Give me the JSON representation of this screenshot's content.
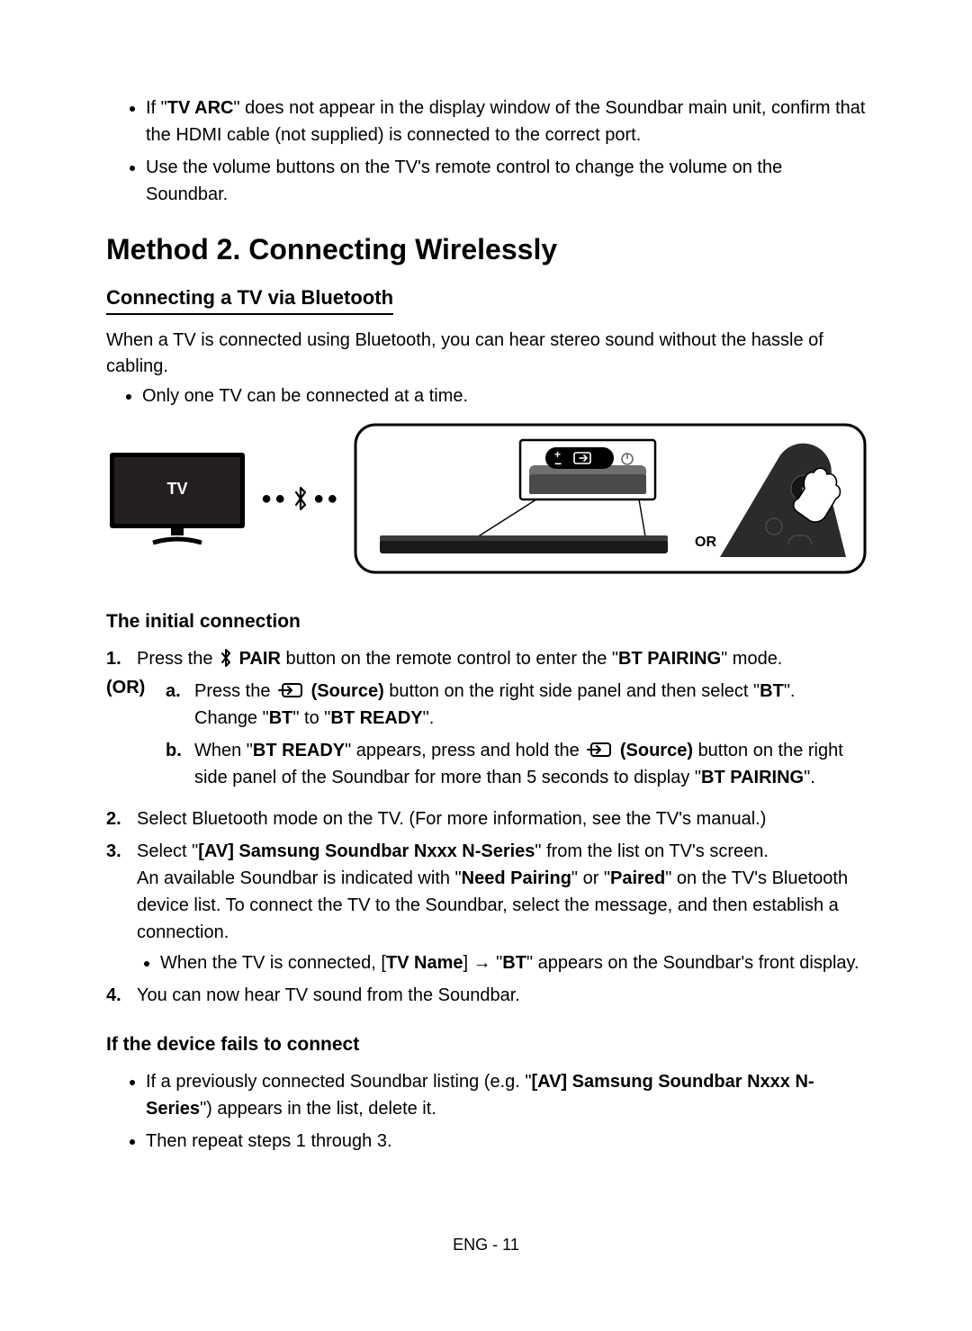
{
  "top_bullets": {
    "b0": {
      "pre": "If \"",
      "bold": "TV ARC",
      "post": "\" does not appear in the display window of the Soundbar main unit, confirm that the HDMI cable (not supplied) is connected to the correct port."
    },
    "b1": "Use the volume buttons on the TV's remote control to change the volume on the Soundbar."
  },
  "method_title": "Method 2. Connecting Wirelessly",
  "subtitle": "Connecting a TV via Bluetooth",
  "intro": "When a TV is connected using Bluetooth, you can hear stereo sound without the hassle of cabling.",
  "single_bullet": "Only one TV can be connected at a time.",
  "diagram": {
    "tv_label": "TV",
    "or_label": "OR",
    "icons": {
      "bluetooth": "bluetooth-icon",
      "source": "source-icon",
      "power": "power-icon"
    }
  },
  "sections": {
    "initial_title": "The initial connection",
    "fail_title": "If the device fails to connect"
  },
  "steps": {
    "s1": {
      "num": "1.",
      "pre": "Press the ",
      "pair_bold": "PAIR",
      "mid": " button on the remote control to enter the \"",
      "bt_pairing": "BT PAIRING",
      "post": "\" mode."
    },
    "or_label": "(OR)",
    "s1a": {
      "letter": "a.",
      "p1_pre": "Press the ",
      "source_bold": "(Source)",
      "p1_mid": " button on the right side panel and then select \"",
      "bt": "BT",
      "p1_post": "\".",
      "p2_pre": "Change \"",
      "p2_bt": "BT",
      "p2_mid": "\" to \"",
      "p2_ready": "BT READY",
      "p2_post": "\"."
    },
    "s1b": {
      "letter": "b.",
      "pre": "When \"",
      "ready": "BT READY",
      "mid1": "\" appears, press and hold the ",
      "source_bold": "(Source)",
      "mid2": " button on the right side panel of the Soundbar for more than 5 seconds to display \"",
      "pairing": "BT PAIRING",
      "post": "\"."
    },
    "s2": {
      "num": "2.",
      "text": "Select Bluetooth mode on the TV. (For more information, see the TV's manual.)"
    },
    "s3": {
      "num": "3.",
      "l1_pre": "Select \"",
      "l1_bold": "[AV] Samsung Soundbar Nxxx N-Series",
      "l1_post": "\" from the list on TV's screen.",
      "l2_pre": "An available Soundbar is indicated with \"",
      "need": "Need Pairing",
      "l2_or": "\" or \"",
      "paired": "Paired",
      "l2_post": "\" on the TV's Bluetooth device list. To connect the TV to the Soundbar, select the message, and then establish a connection.",
      "bullet_pre": "When the TV is connected, [",
      "tvname": "TV Name",
      "bullet_mid": "] → \"",
      "bt": "BT",
      "bullet_post": "\" appears on the Soundbar's front display."
    },
    "s4": {
      "num": "4.",
      "text": "You can now hear TV sound from the Soundbar."
    }
  },
  "fail_bullets": {
    "f0_pre": "If a previously connected Soundbar listing (e.g. \"",
    "f0_bold": "[AV] Samsung Soundbar Nxxx N-Series",
    "f0_post": "\") appears in the list, delete it.",
    "f1": "Then repeat steps 1 through 3."
  },
  "footer": "ENG - 11"
}
